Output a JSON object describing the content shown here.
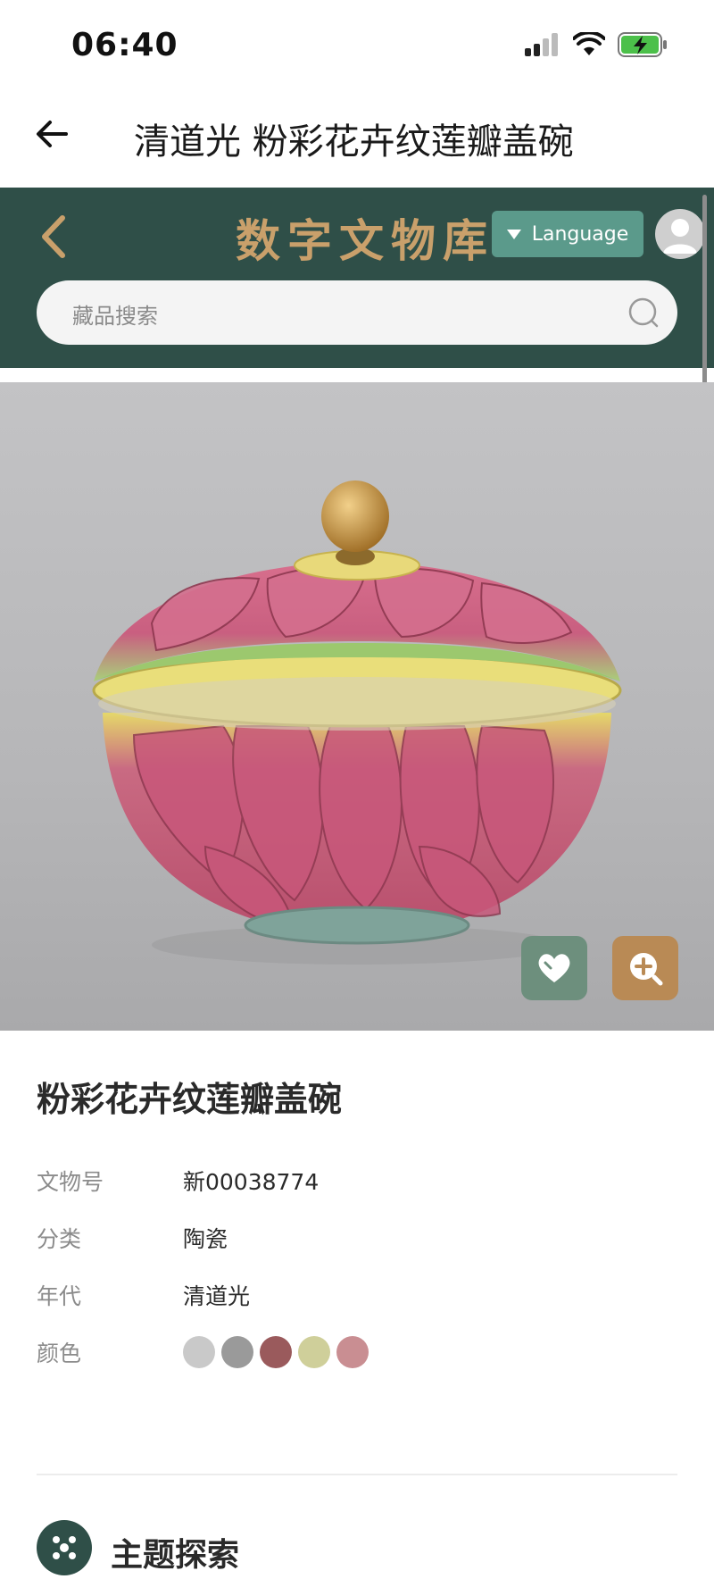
{
  "status_bar": {
    "time": "06:40"
  },
  "header": {
    "title": "清道光 粉彩花卉纹莲瓣盖碗"
  },
  "site": {
    "title": "数字文物库",
    "language_label": "Language",
    "search_placeholder": "藏品搜索"
  },
  "item": {
    "name": "粉彩花卉纹莲瓣盖碗",
    "fields": [
      {
        "label": "文物号",
        "value": "新00038774"
      },
      {
        "label": "分类",
        "value": "陶瓷"
      },
      {
        "label": "年代",
        "value": "清道光"
      },
      {
        "label": "颜色",
        "value": ""
      }
    ],
    "colors": [
      "#c9c9c9",
      "#9a9a9a",
      "#9a5a5c",
      "#cfcf9a",
      "#c98e92"
    ]
  },
  "section": {
    "theme_label": "主题探索"
  },
  "icons": {
    "back": "back-arrow-icon",
    "web_back": "chevron-left-icon",
    "search": "search-icon",
    "favorite": "heart-icon",
    "zoom": "zoom-in-icon",
    "avatar": "user-avatar-icon",
    "theme": "theme-explore-icon"
  },
  "accent": {
    "header_bg": "#2f4f48",
    "gold": "#c9a06b",
    "teal": "#5b9a8b"
  }
}
